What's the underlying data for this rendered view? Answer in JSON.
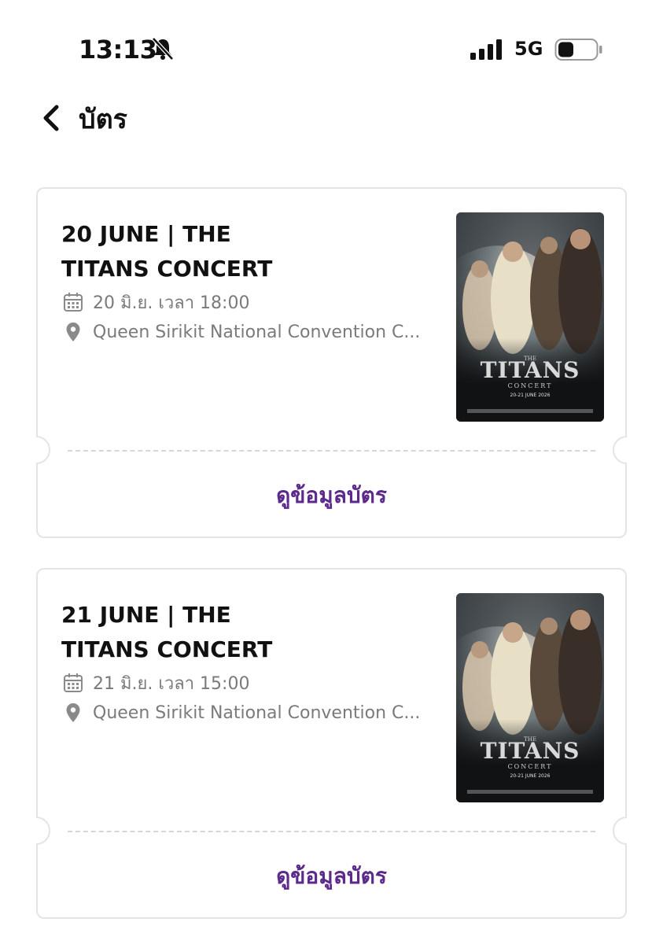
{
  "status_bar": {
    "time": "13:13",
    "network": "5G",
    "icons": [
      "bell-slash-icon",
      "signal-icon",
      "battery-icon"
    ]
  },
  "header": {
    "title": "บัตร",
    "back_icon": "chevron-left-icon"
  },
  "colors": {
    "accent": "#5b2a8c",
    "muted_text": "#7a7a7a",
    "card_border": "#e4e4e4"
  },
  "tickets": [
    {
      "title": "20 JUNE | THE TITANS CONCERT",
      "datetime": "20 มิ.ย. เวลา 18:00",
      "venue": "Queen Sirikit National Convention C...",
      "button_label": "ดูข้อมูลบัตร",
      "poster": {
        "title": "TITANS",
        "title_top": "THE",
        "subtitle": "CONCERT",
        "dates": "20-21 JUNE 2026"
      }
    },
    {
      "title": "21 JUNE | THE TITANS CONCERT",
      "datetime": "21 มิ.ย. เวลา 15:00",
      "venue": "Queen Sirikit National Convention C...",
      "button_label": "ดูข้อมูลบัตร",
      "poster": {
        "title": "TITANS",
        "title_top": "THE",
        "subtitle": "CONCERT",
        "dates": "20-21 JUNE 2026"
      }
    }
  ]
}
